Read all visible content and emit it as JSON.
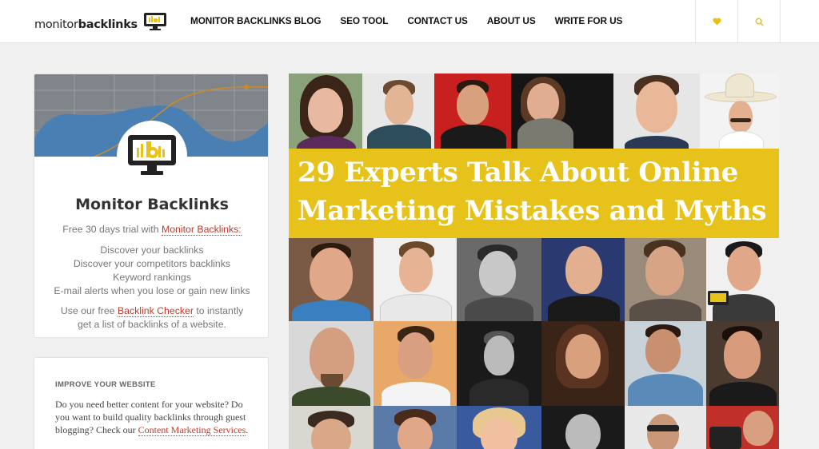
{
  "header": {
    "logo": {
      "text_regular": "monitor",
      "text_bold": "backlinks"
    },
    "nav": [
      {
        "label": "MONITOR BACKLINKS BLOG"
      },
      {
        "label": "SEO TOOL"
      },
      {
        "label": "CONTACT US"
      },
      {
        "label": "ABOUT US"
      },
      {
        "label": "WRITE FOR US"
      }
    ],
    "icons": {
      "favorites": "heart-icon",
      "search": "search-icon"
    }
  },
  "sidebar": {
    "profile_card": {
      "title": "Monitor Backlinks",
      "trial_prefix": "Free 30 days trial with ",
      "trial_link": "Monitor Backlinks:",
      "features": [
        "Discover your backlinks",
        "Discover your competitors backlinks",
        "Keyword rankings",
        "E-mail alerts when you lose or gain new links"
      ],
      "cta_prefix": "Use our free ",
      "cta_link": "Backlink Checker",
      "cta_suffix": " to instantly",
      "cta_line2": "get a list of backlinks of a website."
    },
    "improve_card": {
      "label": "IMPROVE YOUR WEBSITE",
      "text": "Do you need better content for your website? Do you want to build quality backlinks through guest blogging? Check our ",
      "link": "Content Marketing Services",
      "suffix": "."
    }
  },
  "article": {
    "image_title_line1": "29 Experts Talk About Online",
    "image_title_line2": "Marketing Mistakes and Myths"
  },
  "colors": {
    "accent_yellow": "#e7c21a",
    "link_red": "#c0392b",
    "banner_blue": "#4a7fb3"
  }
}
